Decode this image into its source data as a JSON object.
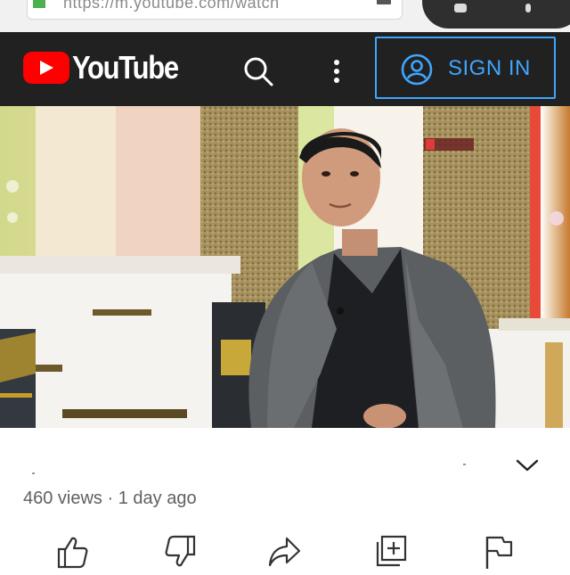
{
  "browser": {
    "url": "https://m.youtube.com/watch"
  },
  "header": {
    "logo_text": "YouTube",
    "search_icon": "search-icon",
    "more_icon": "more-vertical-icon",
    "signin_label": "SIGN IN",
    "signin_icon": "account-circle-icon"
  },
  "video": {
    "title": "",
    "meta": "460 views · 1 day ago",
    "expand_icon": "chevron-down-icon"
  },
  "actions": [
    {
      "name": "like",
      "icon": "thumbs-up-icon"
    },
    {
      "name": "dislike",
      "icon": "thumbs-down-icon"
    },
    {
      "name": "share",
      "icon": "share-icon"
    },
    {
      "name": "save",
      "icon": "add-to-playlist-icon"
    },
    {
      "name": "report",
      "icon": "flag-icon"
    }
  ],
  "colors": {
    "header_bg": "#212121",
    "brand_red": "#ff0000",
    "accent_blue": "#3ea6ff",
    "meta_text": "#606060"
  }
}
